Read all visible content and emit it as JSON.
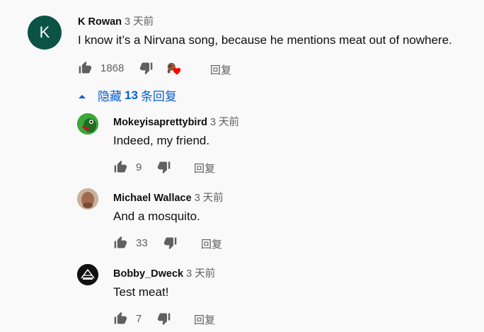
{
  "main_comment": {
    "avatar_letter": "K",
    "author": "K Rowan",
    "time": "3 天前",
    "text": "I know it’s a Nirvana song, because he mentions meat out of nowhere.",
    "likes": "1868",
    "reply_label": "回复"
  },
  "replies_toggle": {
    "prefix": "隐藏",
    "count": "13",
    "suffix": "条回复"
  },
  "replies": [
    {
      "author": "Mokeyisaprettybird",
      "time": "3 天前",
      "text": "Indeed, my friend.",
      "likes": "9",
      "reply_label": "回复"
    },
    {
      "author": "Michael Wallace",
      "time": "3 天前",
      "text": "And a mosquito.",
      "likes": "33",
      "reply_label": "回复"
    },
    {
      "author": "Bobby_Dweck",
      "time": "3 天前",
      "text": "Test meat!",
      "likes": "7",
      "reply_label": "回复"
    }
  ],
  "colors": {
    "avatar_main": "#0b5345",
    "link_blue": "#065fd4",
    "heart_red": "#ff0000"
  }
}
